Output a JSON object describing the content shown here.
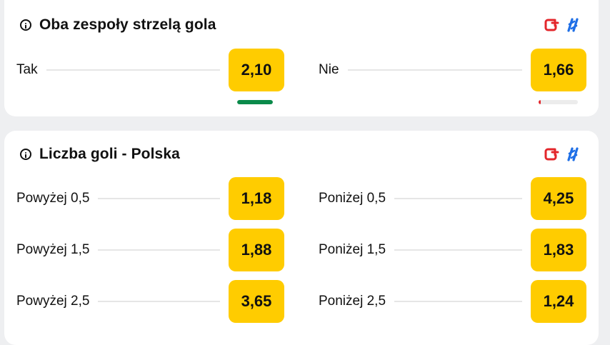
{
  "markets": [
    {
      "title": "Oba zespoły strzelą gola",
      "rows": [
        {
          "left": {
            "label": "Tak",
            "odds": "2,10",
            "trend": {
              "fraction": 1.0,
              "color": "#0a8a4a"
            }
          },
          "right": {
            "label": "Nie",
            "odds": "1,66",
            "trend": {
              "fraction": 0.06,
              "color": "#e3262b"
            }
          }
        }
      ]
    },
    {
      "title": "Liczba goli - Polska",
      "rows": [
        {
          "left": {
            "label": "Powyżej 0,5",
            "odds": "1,18"
          },
          "right": {
            "label": "Poniżej 0,5",
            "odds": "4,25"
          }
        },
        {
          "left": {
            "label": "Powyżej 1,5",
            "odds": "1,88"
          },
          "right": {
            "label": "Poniżej 1,5",
            "odds": "1,83"
          }
        },
        {
          "left": {
            "label": "Powyżej 2,5",
            "odds": "3,65"
          },
          "right": {
            "label": "Poniżej 2,5",
            "odds": "1,24"
          }
        }
      ]
    }
  ],
  "icons": {
    "add_to_betslip": "add-to-betslip-icon",
    "stats": "stats-icon",
    "info": "info-icon"
  },
  "colors": {
    "odds_bg": "#ffcc00",
    "add_icon": "#e3262b",
    "stats_icon": "#1f6fe6",
    "trend_up": "#0a8a4a",
    "trend_down": "#e3262b"
  }
}
